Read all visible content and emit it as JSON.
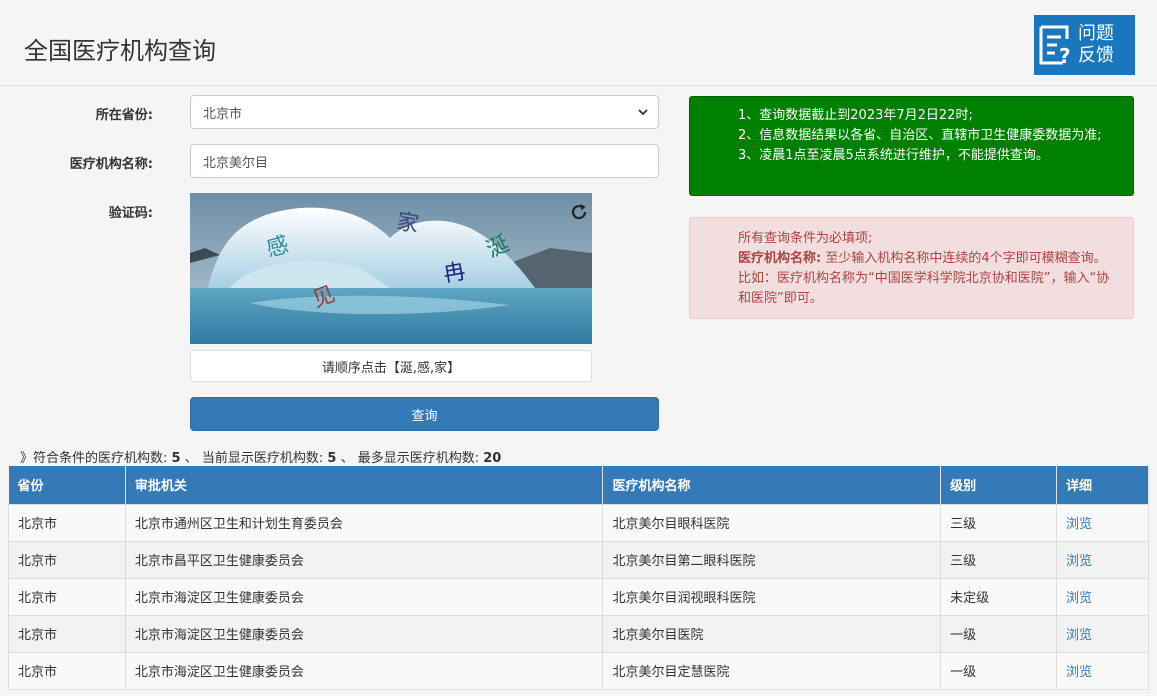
{
  "page_title": "全国医疗机构查询",
  "feedback": {
    "line1": "问题",
    "line2": "反馈"
  },
  "form": {
    "province_label": "所在省份:",
    "province_value": "北京市",
    "name_label": "医疗机构名称:",
    "name_value": "北京美尔目",
    "captcha_label": "验证码:",
    "captcha_chars": [
      "感",
      "见",
      "家",
      "冉",
      "涎"
    ],
    "captcha_hint": "请顺序点击【涎,感,家】",
    "submit_label": "查询"
  },
  "notice_green": {
    "line1": "1、查询数据截止到2023年7月2日22时;",
    "line2": "2、信息数据结果以各省、自治区、直辖市卫生健康委数据为准;",
    "line3": "3、凌晨1点至凌晨5点系统进行维护，不能提供查询。"
  },
  "notice_red": {
    "line1": "所有查询条件为必填项;",
    "bold": "医疗机构名称:",
    "line2": " 至少输入机构名称中连续的4个字即可模糊查询。比如：医疗机构名称为“中国医学科学院北京协和医院”，输入“协和医院”即可。"
  },
  "summary": {
    "prefix": "》符合条件的医疗机构数:",
    "match_count": "5",
    "sep1": "、 当前显示医疗机构数:",
    "shown_count": "5",
    "sep2": "、 最多显示医疗机构数:",
    "max_count": "20"
  },
  "table": {
    "headers": [
      "省份",
      "审批机关",
      "医疗机构名称",
      "级别",
      "详细"
    ],
    "rows": [
      [
        "北京市",
        "北京市通州区卫生和计划生育委员会",
        "北京美尔目眼科医院",
        "三级",
        "浏览"
      ],
      [
        "北京市",
        "北京市昌平区卫生健康委员会",
        "北京美尔目第二眼科医院",
        "三级",
        "浏览"
      ],
      [
        "北京市",
        "北京市海淀区卫生健康委员会",
        "北京美尔目润视眼科医院",
        "未定级",
        "浏览"
      ],
      [
        "北京市",
        "北京市海淀区卫生健康委员会",
        "北京美尔目医院",
        "一级",
        "浏览"
      ],
      [
        "北京市",
        "北京市海淀区卫生健康委员会",
        "北京美尔目定慧医院",
        "一级",
        "浏览"
      ]
    ]
  },
  "colors": {
    "primary": "#337ab7",
    "feedback": "#1a77bd",
    "notice_green": "#008000",
    "notice_red_bg": "#f2dede",
    "notice_red_text": "#a94442"
  }
}
